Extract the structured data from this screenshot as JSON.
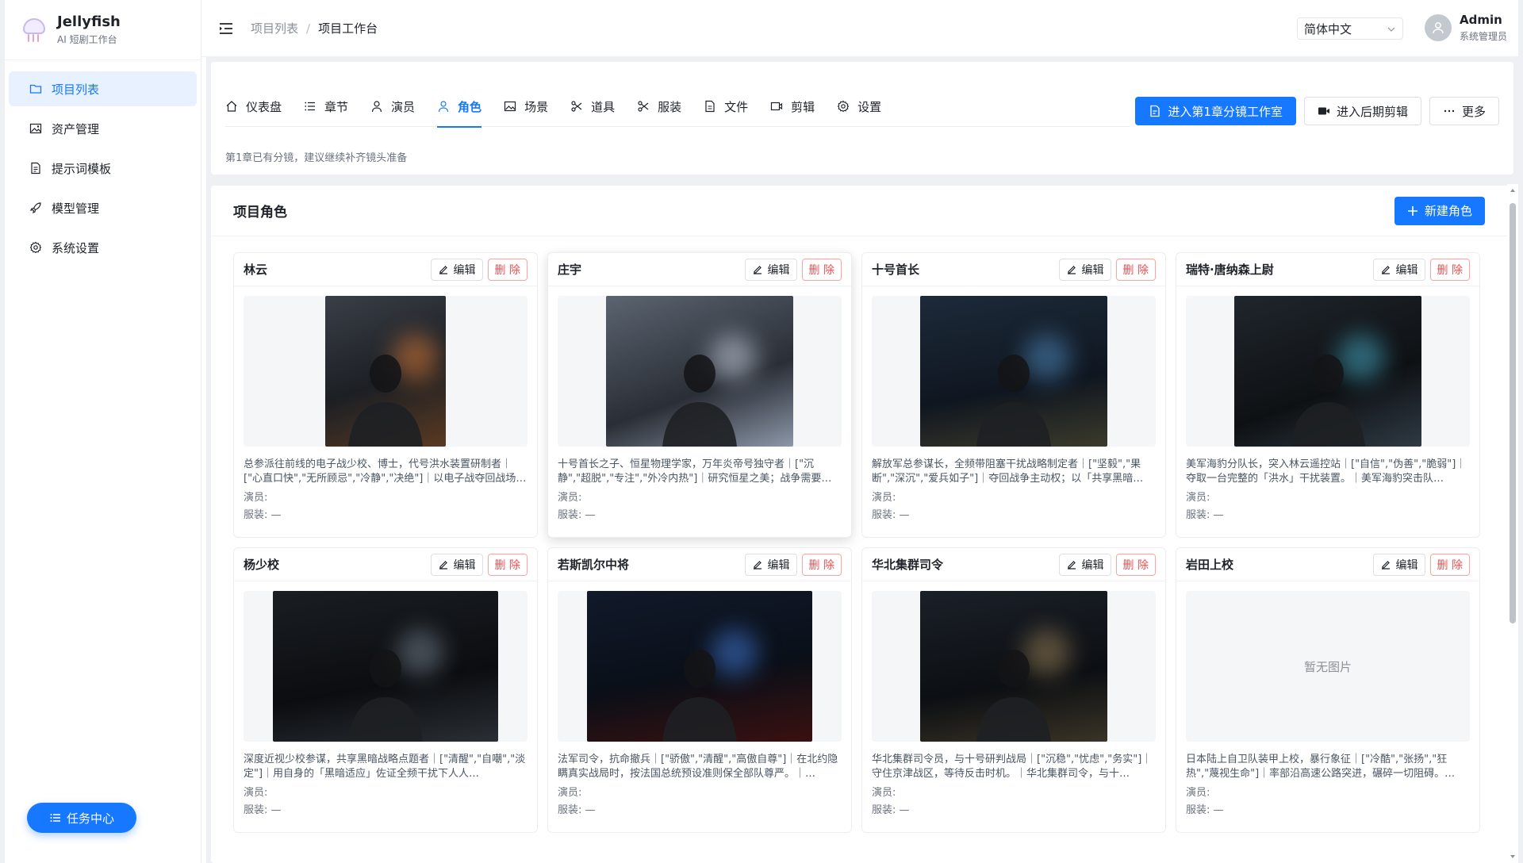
{
  "brand": {
    "name": "Jellyfish",
    "subtitle": "AI 短剧工作台"
  },
  "sidebar": {
    "items": [
      {
        "label": "项目列表",
        "icon": "folder-icon",
        "active": true
      },
      {
        "label": "资产管理",
        "icon": "image-icon"
      },
      {
        "label": "提示词模板",
        "icon": "document-icon"
      },
      {
        "label": "模型管理",
        "icon": "rocket-icon"
      },
      {
        "label": "系统设置",
        "icon": "gear-icon"
      }
    ],
    "task_center": "任务中心"
  },
  "header": {
    "breadcrumb_root": "项目列表",
    "breadcrumb_sep": "/",
    "breadcrumb_current": "项目工作台",
    "language": "简体中文",
    "user_name": "Admin",
    "user_role": "系统管理员"
  },
  "tabs": [
    {
      "label": "仪表盘",
      "icon": "home-icon"
    },
    {
      "label": "章节",
      "icon": "list-icon"
    },
    {
      "label": "演员",
      "icon": "user-icon"
    },
    {
      "label": "角色",
      "icon": "user-icon",
      "active": true
    },
    {
      "label": "场景",
      "icon": "image-icon"
    },
    {
      "label": "道具",
      "icon": "scissors-icon"
    },
    {
      "label": "服装",
      "icon": "scissors-icon"
    },
    {
      "label": "文件",
      "icon": "document-icon"
    },
    {
      "label": "剪辑",
      "icon": "video-icon"
    },
    {
      "label": "设置",
      "icon": "gear-icon"
    }
  ],
  "actions": {
    "storyboard": "进入第1章分镜工作室",
    "post_edit": "进入后期剪辑",
    "more": "更多"
  },
  "hint": "第1章已有分镜，建议继续补齐镜头准备",
  "roles": {
    "title": "项目角色",
    "new_button": "新建角色",
    "edit_label": "编辑",
    "delete_label": "删 除",
    "actor_label": "演员:",
    "costume_label": "服装: —",
    "no_image": "暂无图片",
    "items": [
      {
        "name": "林云",
        "desc": "总参派往前线的电子战少校、博士，代号洪水装置研制者｜[\"心直口快\",\"无所顾忌\",\"冷静\",\"决绝\"]｜以电子战夺回战场…",
        "has_image": true
      },
      {
        "name": "庄宇",
        "desc": "十号首长之子、恒星物理学家，万年炎帝号独守者｜[\"沉静\",\"超脱\",\"专注\",\"外冷内热\"]｜研究恒星之美；战争需要…",
        "has_image": true
      },
      {
        "name": "十号首长",
        "desc": "解放军总参谋长，全频带阻塞干扰战略制定者｜[\"坚毅\",\"果断\",\"深沉\",\"爱兵如子\"]｜夺回战争主动权；以「共享黑暗…",
        "has_image": true
      },
      {
        "name": "瑞特·唐纳森上尉",
        "desc": "美军海豹分队长，突入林云遥控站｜[\"自信\",\"伪善\",\"脆弱\"]｜夺取一台完整的「洪水」干扰装置。｜美军海豹突击队…",
        "has_image": true
      },
      {
        "name": "杨少校",
        "desc": "深度近视少校参谋，共享黑暗战略点题者｜[\"清醒\",\"自嘲\",\"淡定\"]｜用自身的「黑暗适应」佐证全频干扰下人人…",
        "has_image": true
      },
      {
        "name": "若斯凯尔中将",
        "desc": "法军司令，抗命撤兵｜[\"骄傲\",\"清醒\",\"高傲自尊\"]｜在北约隐瞒真实战局时，按法国总统预设准则保全部队尊严。｜…",
        "has_image": true
      },
      {
        "name": "华北集群司令",
        "desc": "华北集群司令员，与十号研判战局｜[\"沉稳\",\"忧虑\",\"务实\"]｜守住京津战区，等待反击时机。｜华北集群司令，与十…",
        "has_image": true
      },
      {
        "name": "岩田上校",
        "desc": "日本陆上自卫队装甲上校，暴行象征｜[\"冷酷\",\"张扬\",\"狂热\",\"蔑视生命\"]｜率部沿高速公路突进，碾碎一切阻碍。…",
        "has_image": false
      }
    ]
  },
  "colors": {
    "accent": "#1677ff",
    "danger": "#ff4d4f"
  }
}
